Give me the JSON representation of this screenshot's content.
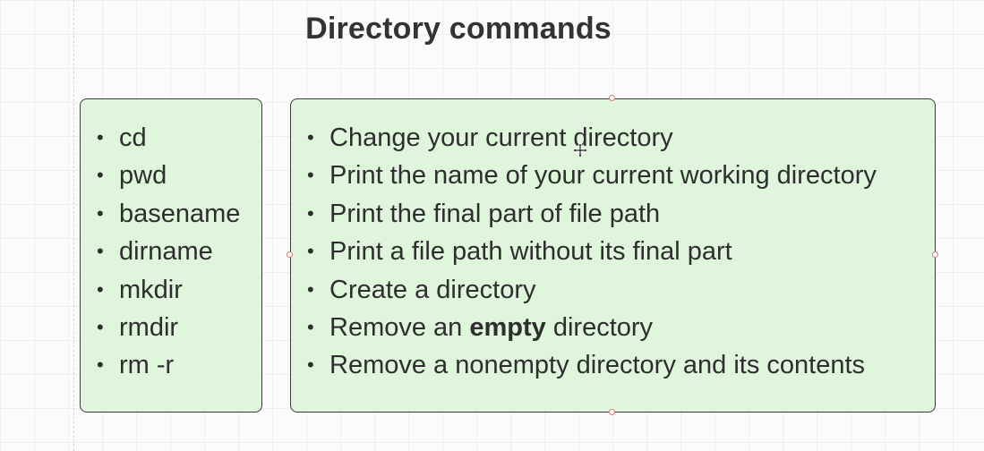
{
  "title": "Directory commands",
  "commands": [
    "cd",
    "pwd",
    "basename",
    "dirname",
    "mkdir",
    "rmdir",
    "rm -r"
  ],
  "descriptions": [
    {
      "text": "Change your current directory"
    },
    {
      "text": "Print the name of your current working directory"
    },
    {
      "text": "Print the final part of file path"
    },
    {
      "text": "Print a file path without its final part"
    },
    {
      "text": "Create a directory"
    },
    {
      "before": "Remove an ",
      "bold": "empty",
      "after": " directory"
    },
    {
      "text": "Remove a nonempty directory and its contents"
    }
  ],
  "bullet_glyph": "•",
  "colors": {
    "card_fill": "#dff6dd",
    "card_border": "#3c3c3c",
    "handle": "#e07a7a",
    "text": "#2e2e2e"
  },
  "icons": {
    "selection_handle": "selection-handle-icon",
    "cursor": "move-cursor-icon"
  }
}
